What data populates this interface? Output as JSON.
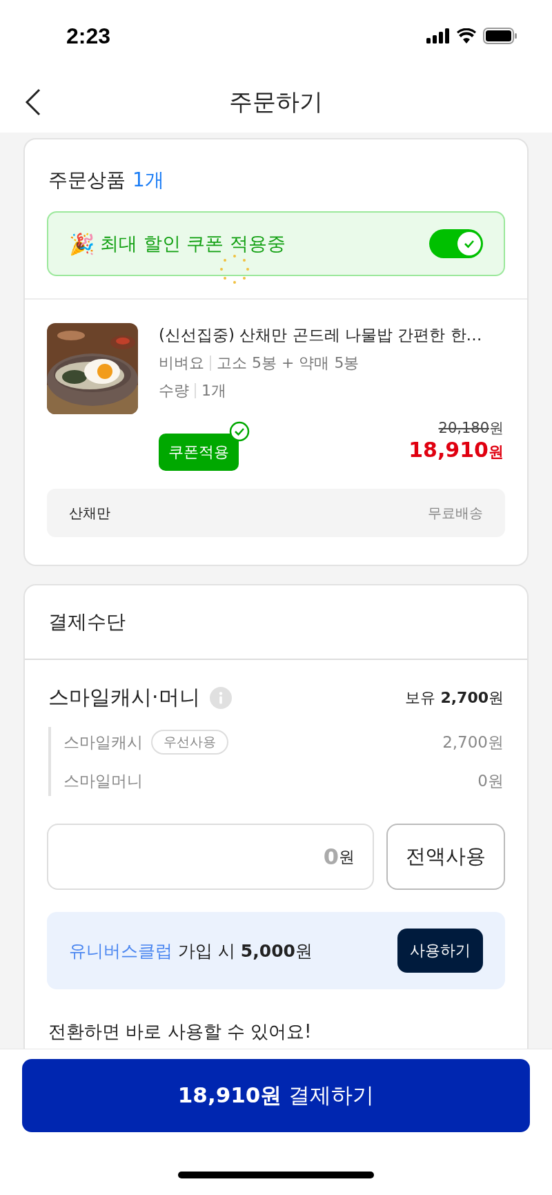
{
  "status_bar": {
    "time": "2:23"
  },
  "header": {
    "title": "주문하기"
  },
  "order": {
    "title": "주문상품",
    "count": "1개",
    "coupon_banner": {
      "emoji": "🎉",
      "text": "최대 할인 쿠폰 적용중",
      "on": true
    },
    "product": {
      "title": "(신선집중) 산채만 곤드레 나물밥 간편한 한…",
      "options": [
        {
          "label": "비벼요",
          "value": "고소 5봉 + 약매 5봉"
        },
        {
          "label": "수량",
          "value": "1개"
        }
      ],
      "coupon_badge": "쿠폰적용",
      "original_price": "20,180",
      "original_unit": "원",
      "price": "18,910",
      "price_unit": "원"
    },
    "shipping": {
      "seller": "산채만",
      "fee": "무료배송"
    }
  },
  "payment": {
    "title": "결제수단",
    "method": "스마일캐시·머니",
    "balance_label": "보유",
    "balance": "2,700",
    "balance_unit": "원",
    "items": [
      {
        "name": "스마일캐시",
        "tag": "우선사용",
        "amount": "2,700원"
      },
      {
        "name": "스마일머니",
        "amount": "0원"
      }
    ],
    "input": {
      "value": "0",
      "unit": "원"
    },
    "use_all_button": "전액사용",
    "promo": {
      "link": "유니버스클럽",
      "text": "가입 시 **5,000**원",
      "button": "사용하기"
    },
    "note": "전환하면 바로 사용할 수 있어요!"
  },
  "pay_button": {
    "amount": "18,910원",
    "label": "결제하기"
  }
}
